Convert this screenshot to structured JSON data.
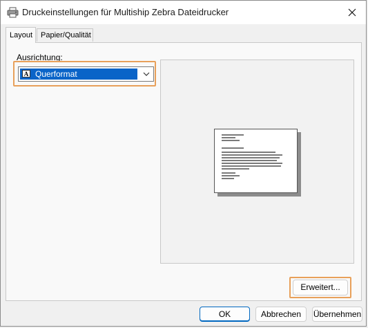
{
  "window": {
    "title": "Druckeinstellungen für Multiship Zebra Dateidrucker",
    "close_label": "✕"
  },
  "tabs": [
    {
      "label": "Layout",
      "active": true
    },
    {
      "label": "Papier/Qualität",
      "active": false
    }
  ],
  "layout": {
    "orientation_label": "Ausrichtung:",
    "orientation_value": "Querformat",
    "orientation_icon_letter": "A",
    "advanced_label": "Erweitert..."
  },
  "footer": {
    "ok_label": "OK",
    "cancel_label": "Abbrechen",
    "apply_label": "Übernehmen"
  },
  "colors": {
    "accent": "#0a64c8",
    "highlight": "#e8a05a"
  }
}
